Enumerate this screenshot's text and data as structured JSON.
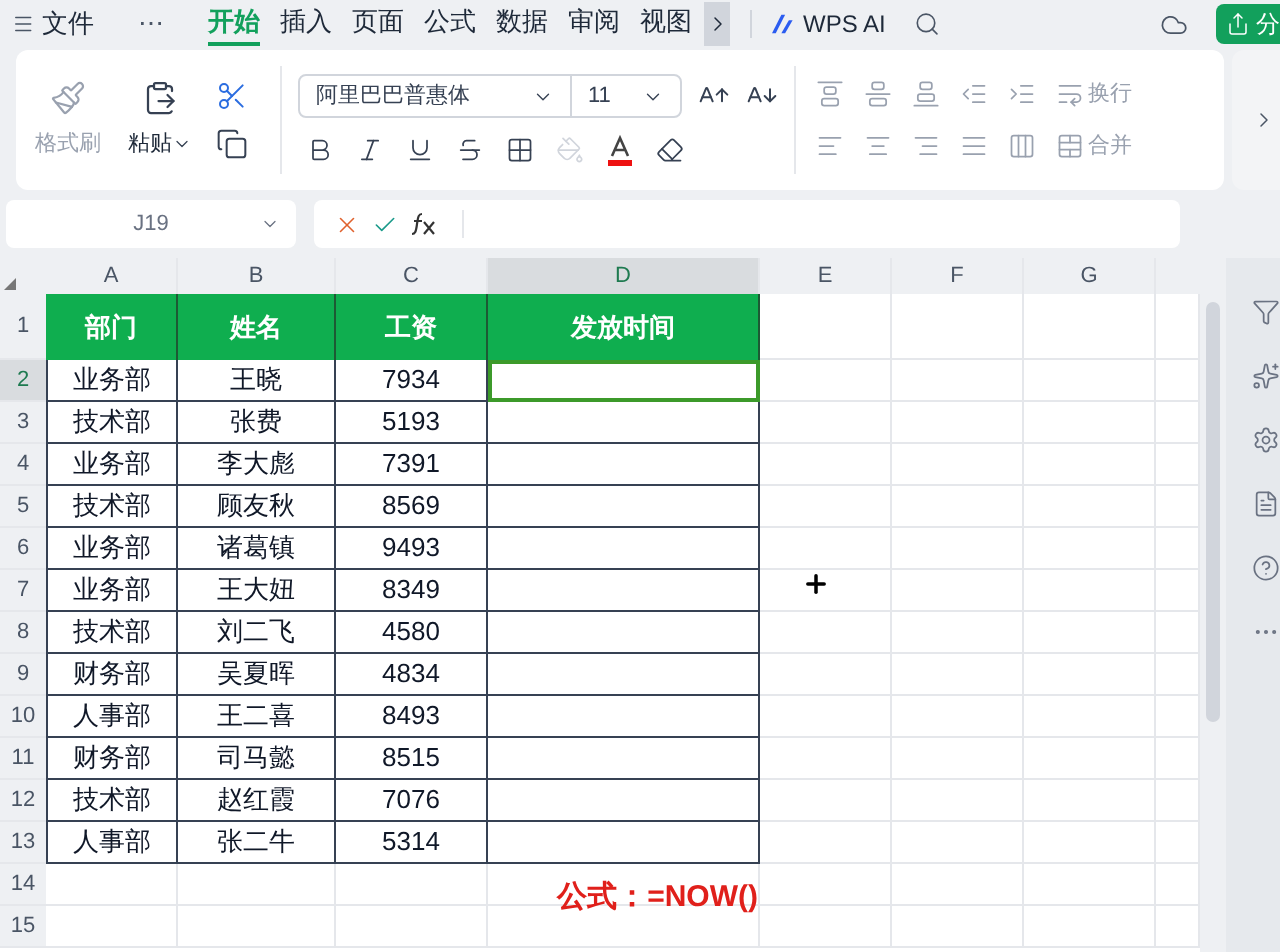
{
  "top_bar": {
    "menu": "文件",
    "more": "⋯",
    "tabs": [
      {
        "label": "开始",
        "selected": true
      },
      {
        "label": "插入",
        "selected": false
      },
      {
        "label": "页面",
        "selected": false
      },
      {
        "label": "公式",
        "selected": false
      },
      {
        "label": "数据",
        "selected": false
      },
      {
        "label": "审阅",
        "selected": false
      },
      {
        "label": "视图",
        "selected": false
      }
    ],
    "ai": "WPS AI",
    "share": "分"
  },
  "ribbon": {
    "format_painter": {
      "label": "格式刷",
      "disabled": true
    },
    "paste": {
      "label": "粘贴",
      "disabled": false
    },
    "font": "阿里巴巴普惠体",
    "size": "11",
    "wrap": {
      "label": "换行",
      "disabled": true
    },
    "merge": {
      "label": "合并",
      "disabled": true
    }
  },
  "formula_bar": {
    "name_box": "J19"
  },
  "sheet": {
    "columns": [
      {
        "label": "A",
        "selected": false
      },
      {
        "label": "B",
        "selected": false
      },
      {
        "label": "C",
        "selected": false
      },
      {
        "label": "D",
        "selected": true
      },
      {
        "label": "E",
        "selected": false
      },
      {
        "label": "F",
        "selected": false
      },
      {
        "label": "G",
        "selected": false
      }
    ],
    "header": [
      "部门",
      "姓名",
      "工资",
      "发放时间"
    ],
    "rows": [
      {
        "cells": [
          "业务部",
          "王晓",
          "7934"
        ],
        "active": true
      },
      {
        "cells": [
          "技术部",
          "张费",
          "5193"
        ],
        "active": false
      },
      {
        "cells": [
          "业务部",
          "李大彪",
          "7391"
        ],
        "active": false
      },
      {
        "cells": [
          "技术部",
          "顾友秋",
          "8569"
        ],
        "active": false
      },
      {
        "cells": [
          "业务部",
          "诸葛镇",
          "9493"
        ],
        "active": false
      },
      {
        "cells": [
          "业务部",
          "王大妞",
          "8349"
        ],
        "active": false
      },
      {
        "cells": [
          "技术部",
          "刘二飞",
          "4580"
        ],
        "active": false
      },
      {
        "cells": [
          "财务部",
          "吴夏晖",
          "4834"
        ],
        "active": false
      },
      {
        "cells": [
          "人事部",
          "王二喜",
          "8493"
        ],
        "active": false
      },
      {
        "cells": [
          "财务部",
          "司马懿",
          "8515"
        ],
        "active": false
      },
      {
        "cells": [
          "技术部",
          "赵红霞",
          "7076"
        ],
        "active": false
      },
      {
        "cells": [
          "人事部",
          "张二牛",
          "5314"
        ],
        "active": false
      }
    ],
    "row_numbers": [
      "1",
      "2",
      "3",
      "4",
      "5",
      "6",
      "7",
      "8",
      "9",
      "10",
      "11",
      "12",
      "13",
      "14",
      "15"
    ],
    "note": "公式：=NOW()"
  }
}
